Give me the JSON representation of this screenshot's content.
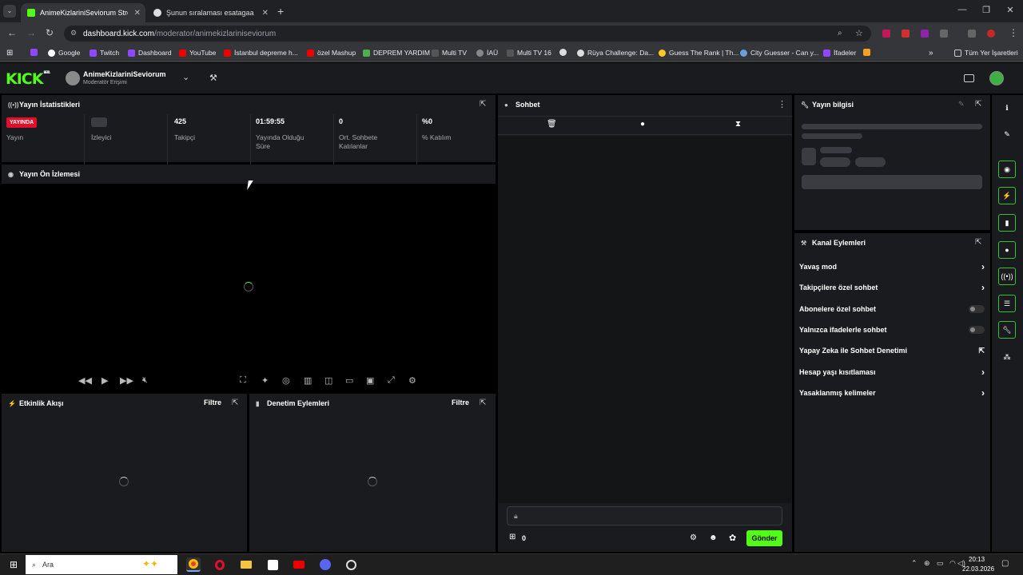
{
  "browser": {
    "tabs": [
      {
        "label": "AnimeKizlariniSeviorum Stream",
        "active": true
      },
      {
        "label": "Şunun sıralaması esatagaa | Ya",
        "active": false
      }
    ],
    "url_host": "dashboard.kick.com",
    "url_path": "/moderator/animekizlariniseviorum",
    "bookmarks": [
      "Google",
      "Twitch",
      "Dashboard",
      "YouTube",
      "İstanbul depreme h...",
      "özel Mashup",
      "DEPREM YARDIM",
      "Multi TV",
      "İAÜ",
      "Multi TV 16",
      "Rüya Challenge: Da...",
      "Guess The Rank | Th...",
      "City Guesser - Can y...",
      "İfadeler"
    ],
    "all_bookmarks": "Tüm Yer İşaretleri"
  },
  "header": {
    "logo": "KICK",
    "logo_sup": "BETA",
    "channel_name": "AnimeKizlariniSeviorum",
    "role": "Moderatör Erişimi"
  },
  "stats_panel": {
    "title": "Yayın İstatistikleri",
    "stats": [
      {
        "value": "YAYINDA",
        "label": "Yayın"
      },
      {
        "value": "",
        "label": "İzleyici"
      },
      {
        "value": "425",
        "label": "Takipçi"
      },
      {
        "value": "01:59:55",
        "label": "Yayında Olduğu Süre"
      },
      {
        "value": "0",
        "label": "Ort. Sohbete Katılanlar"
      },
      {
        "value": "%0",
        "label": "% Katılım"
      }
    ]
  },
  "preview_panel": {
    "title": "Yayın Ön İzlemesi"
  },
  "activity_panel": {
    "title": "Etkinlik Akışı",
    "filter": "Filtre"
  },
  "moderation_panel": {
    "title": "Denetim Eylemleri",
    "filter": "Filtre"
  },
  "chat_panel": {
    "title": "Sohbet",
    "count": "0",
    "send": "Gönder"
  },
  "stream_info_panel": {
    "title": "Yayın bilgisi"
  },
  "channel_actions": {
    "title": "Kanal Eylemleri",
    "items": [
      {
        "label": "Yavaş mod",
        "kind": "arrow"
      },
      {
        "label": "Takipçilere özel sohbet",
        "kind": "arrow"
      },
      {
        "label": "Abonelere özel sohbet",
        "kind": "toggle"
      },
      {
        "label": "Yalnızca ifadelerle sohbet",
        "kind": "toggle"
      },
      {
        "label": "Yapay Zeka ile Sohbet Denetimi",
        "kind": "external"
      },
      {
        "label": "Hesap yaşı kısıtlaması",
        "kind": "arrow"
      },
      {
        "label": "Yasaklanmış kelimeler",
        "kind": "arrow"
      }
    ]
  },
  "taskbar": {
    "search": "Ara",
    "time": "20:13",
    "date": "22.03.2026"
  },
  "colors": {
    "kick_green": "#53fc18",
    "live_red": "#e0102a",
    "send_green": "#53fc18"
  }
}
